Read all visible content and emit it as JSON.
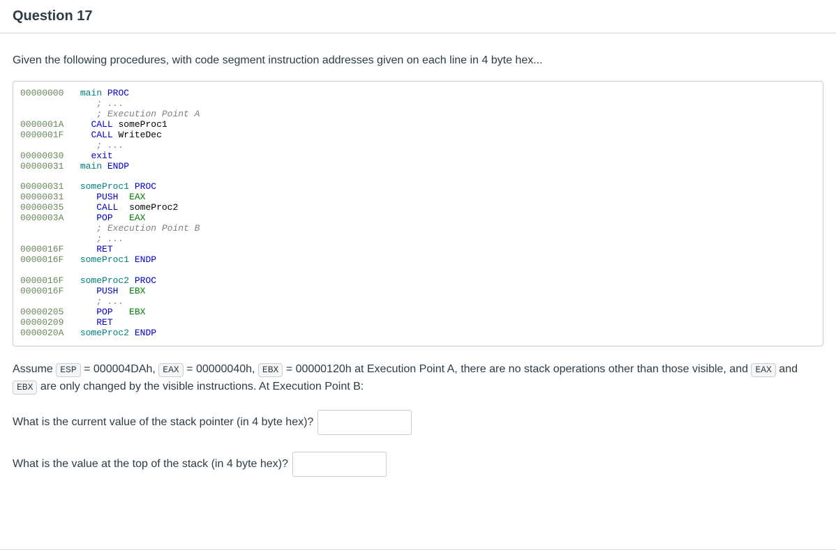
{
  "header": {
    "title": "Question 17"
  },
  "intro": "Given the following procedures, with code segment instruction addresses given on each line in 4 byte hex...",
  "code": {
    "lines": [
      {
        "addr": "00000000",
        "pad": "   ",
        "tokens": [
          {
            "t": "main",
            "c": "label"
          },
          {
            "t": " ",
            "c": "op"
          },
          {
            "t": "PROC",
            "c": "kw"
          }
        ]
      },
      {
        "addr": "        ",
        "pad": "      ",
        "tokens": [
          {
            "t": "; ...",
            "c": "cmt"
          }
        ]
      },
      {
        "addr": "        ",
        "pad": "      ",
        "tokens": [
          {
            "t": "; Execution Point A",
            "c": "cmt"
          }
        ]
      },
      {
        "addr": "0000001A",
        "pad": "     ",
        "tokens": [
          {
            "t": "CALL",
            "c": "kw"
          },
          {
            "t": " ",
            "c": "op"
          },
          {
            "t": "someProc1",
            "c": "op"
          }
        ]
      },
      {
        "addr": "0000001F",
        "pad": "     ",
        "tokens": [
          {
            "t": "CALL",
            "c": "kw"
          },
          {
            "t": " ",
            "c": "op"
          },
          {
            "t": "WriteDec",
            "c": "op"
          }
        ]
      },
      {
        "addr": "        ",
        "pad": "      ",
        "tokens": [
          {
            "t": "; ...",
            "c": "cmt"
          }
        ]
      },
      {
        "addr": "00000030",
        "pad": "     ",
        "tokens": [
          {
            "t": "exit",
            "c": "kw"
          }
        ]
      },
      {
        "addr": "00000031",
        "pad": "   ",
        "tokens": [
          {
            "t": "main",
            "c": "label"
          },
          {
            "t": " ",
            "c": "op"
          },
          {
            "t": "ENDP",
            "c": "kw"
          }
        ]
      },
      {
        "blank": true
      },
      {
        "addr": "00000031",
        "pad": "   ",
        "tokens": [
          {
            "t": "someProc1",
            "c": "label"
          },
          {
            "t": " ",
            "c": "op"
          },
          {
            "t": "PROC",
            "c": "kw"
          }
        ]
      },
      {
        "addr": "00000031",
        "pad": "      ",
        "tokens": [
          {
            "t": "PUSH",
            "c": "kw"
          },
          {
            "t": "  ",
            "c": "op"
          },
          {
            "t": "EAX",
            "c": "reg"
          }
        ]
      },
      {
        "addr": "00000035",
        "pad": "      ",
        "tokens": [
          {
            "t": "CALL",
            "c": "kw"
          },
          {
            "t": "  ",
            "c": "op"
          },
          {
            "t": "someProc2",
            "c": "op"
          }
        ]
      },
      {
        "addr": "0000003A",
        "pad": "      ",
        "tokens": [
          {
            "t": "POP",
            "c": "kw"
          },
          {
            "t": "   ",
            "c": "op"
          },
          {
            "t": "EAX",
            "c": "reg"
          }
        ]
      },
      {
        "addr": "        ",
        "pad": "      ",
        "tokens": [
          {
            "t": "; Execution Point B",
            "c": "cmt"
          }
        ]
      },
      {
        "addr": "        ",
        "pad": "      ",
        "tokens": [
          {
            "t": "; ...",
            "c": "cmt"
          }
        ]
      },
      {
        "addr": "0000016F",
        "pad": "      ",
        "tokens": [
          {
            "t": "RET",
            "c": "kw"
          }
        ]
      },
      {
        "addr": "0000016F",
        "pad": "   ",
        "tokens": [
          {
            "t": "someProc1",
            "c": "label"
          },
          {
            "t": " ",
            "c": "op"
          },
          {
            "t": "ENDP",
            "c": "kw"
          }
        ]
      },
      {
        "blank": true
      },
      {
        "addr": "0000016F",
        "pad": "   ",
        "tokens": [
          {
            "t": "someProc2",
            "c": "label"
          },
          {
            "t": " ",
            "c": "op"
          },
          {
            "t": "PROC",
            "c": "kw"
          }
        ]
      },
      {
        "addr": "0000016F",
        "pad": "      ",
        "tokens": [
          {
            "t": "PUSH",
            "c": "kw"
          },
          {
            "t": "  ",
            "c": "op"
          },
          {
            "t": "EBX",
            "c": "reg"
          }
        ]
      },
      {
        "addr": "        ",
        "pad": "      ",
        "tokens": [
          {
            "t": "; ...",
            "c": "cmt"
          }
        ]
      },
      {
        "addr": "00000205",
        "pad": "      ",
        "tokens": [
          {
            "t": "POP",
            "c": "kw"
          },
          {
            "t": "   ",
            "c": "op"
          },
          {
            "t": "EBX",
            "c": "reg"
          }
        ]
      },
      {
        "addr": "00000209",
        "pad": "      ",
        "tokens": [
          {
            "t": "RET",
            "c": "kw"
          }
        ]
      },
      {
        "addr": "0000020A",
        "pad": "   ",
        "tokens": [
          {
            "t": "someProc2",
            "c": "label"
          },
          {
            "t": " ",
            "c": "op"
          },
          {
            "t": "ENDP",
            "c": "kw"
          }
        ]
      }
    ]
  },
  "assumption": {
    "pre_esp": "Assume ",
    "chip_esp": "ESP",
    "eq_esp": " = 000004DAh, ",
    "chip_eax": "EAX",
    "eq_eax": " = 00000040h, ",
    "chip_ebx": "EBX",
    "eq_ebx": " = 00000120h at Execution Point A, there are no stack operations other than those visible, and ",
    "chip_eax2": "EAX",
    "and": " and ",
    "chip_ebx2": "EBX",
    "tail": " are only changed by the visible instructions. At Execution Point B:"
  },
  "questions": {
    "q1": "What is the current value of the stack pointer (in 4 byte hex)?",
    "q2": "What is the value at the top of the stack (in 4 byte hex)?"
  }
}
